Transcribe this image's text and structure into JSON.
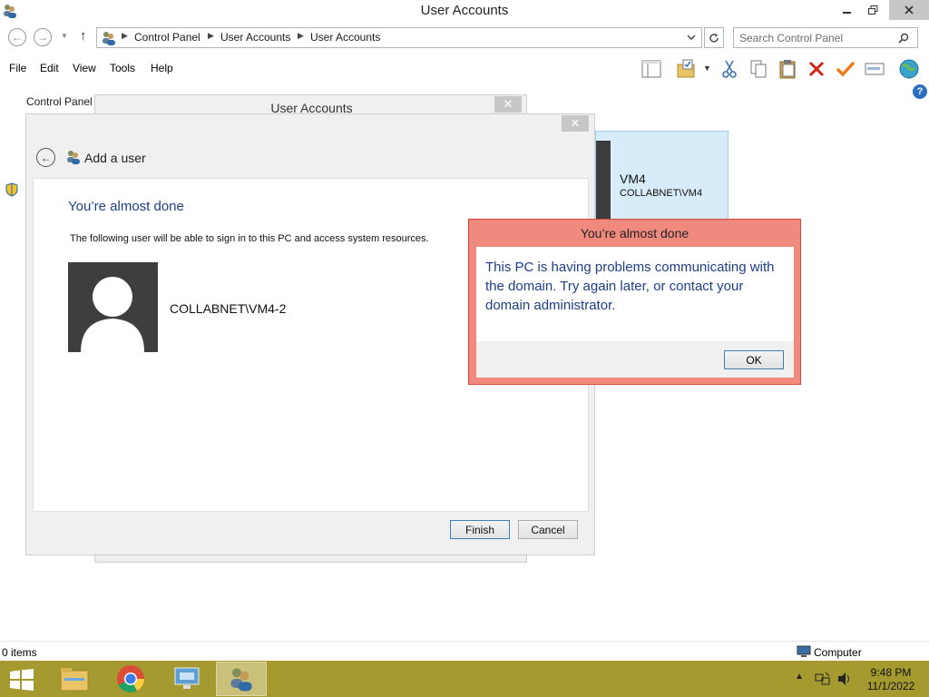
{
  "window": {
    "title": "User Accounts"
  },
  "address": {
    "crumbs": [
      "Control Panel",
      "User Accounts",
      "User Accounts"
    ]
  },
  "search": {
    "placeholder": "Search Control Panel"
  },
  "menu": [
    "File",
    "Edit",
    "View",
    "Tools",
    "Help"
  ],
  "toolbar_icons": [
    "layout-pane-icon",
    "folder-check-icon",
    "cut-icon",
    "copy-icon",
    "paste-icon",
    "delete-icon",
    "check-icon",
    "properties-icon",
    "globe-icon"
  ],
  "left_nav": {
    "label": "Control Panel"
  },
  "bg_window": {
    "title": "User Accounts"
  },
  "background_user": {
    "name": "VM4",
    "domain": "COLLABNET\\VM4"
  },
  "dialog": {
    "heading": "Add a user",
    "title": "You’re almost done",
    "description": "The following user will be able to sign in to this PC and access system resources.",
    "user": "COLLABNET\\VM4-2",
    "finish_label": "Finish",
    "cancel_label": "Cancel"
  },
  "message_box": {
    "title": "You’re almost done",
    "text": "This PC is having problems communicating with the domain. Try again later, or contact your domain administrator.",
    "ok_label": "OK"
  },
  "status": {
    "items": "0 items",
    "location": "Computer"
  },
  "clock": {
    "time": "9:48 PM",
    "date": "11/1/2022"
  },
  "colors": {
    "taskbar": "#a49a2f",
    "error_frame": "#f08a7f",
    "heading_blue": "#1e3e8a"
  }
}
